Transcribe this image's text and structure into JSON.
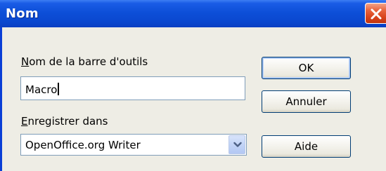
{
  "window": {
    "title": "Nom"
  },
  "form": {
    "name_label_mnemonic": "N",
    "name_label_rest": "om de la barre d'outils",
    "name_value": "Macro",
    "save_label_mnemonic": "E",
    "save_label_rest": "nregistrer dans",
    "save_in_value": "OpenOffice.org Writer"
  },
  "buttons": {
    "ok": "OK",
    "cancel": "Annuler",
    "help": "Aide"
  },
  "icons": {
    "close": "close-icon",
    "dropdown": "chevron-down-icon"
  },
  "colors": {
    "titlebar": "#0a47cf",
    "close_button": "#d8431c",
    "dialog_background": "#eeede5",
    "button_border": "#003c74",
    "field_border": "#7f9db9"
  }
}
